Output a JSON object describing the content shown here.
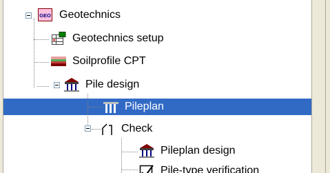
{
  "tree": {
    "items": [
      {
        "label": "Geotechnics",
        "icon": "geo-logo-icon",
        "expanded": true,
        "level": 0
      },
      {
        "label": "Geotechnics setup",
        "icon": "setup-table-icon",
        "level": 1
      },
      {
        "label": "Soilprofile CPT",
        "icon": "soil-layers-icon",
        "level": 1
      },
      {
        "label": "Pile design",
        "icon": "pile-design-icon",
        "expanded": true,
        "level": 1
      },
      {
        "label": "Pileplan",
        "icon": "pileplan-icon",
        "selected": true,
        "level": 2
      },
      {
        "label": "Check",
        "icon": "check-bracket-icon",
        "expanded": true,
        "level": 2
      },
      {
        "label": "Pileplan design",
        "icon": "pile-design-icon",
        "level": 3
      },
      {
        "label": "Pile-type verification",
        "icon": "verification-icon",
        "level": 3
      }
    ]
  },
  "colors": {
    "selection": "#316ac5",
    "frame": "#ece9d8",
    "dotted_line": "#808080"
  }
}
